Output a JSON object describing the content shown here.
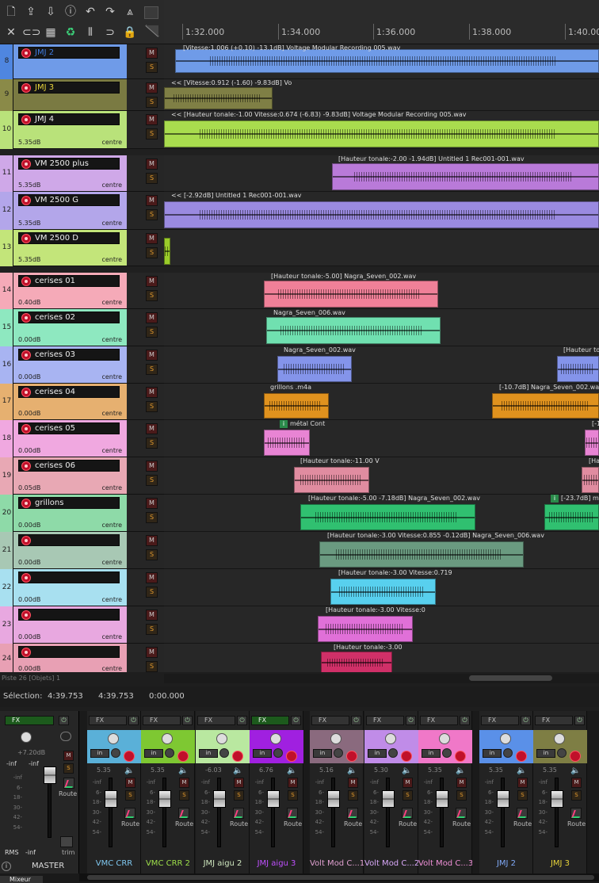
{
  "toolbar": {
    "row1": [
      "new-file-icon",
      "save-up-icon",
      "save-down-icon",
      "info-icon",
      "undo-icon",
      "redo-icon",
      "metronome-icon"
    ],
    "row2": [
      "crossfade-icon",
      "link-icon",
      "grid-icon",
      "loop-icon",
      "ripple-icon",
      "snap-icon",
      "lock-icon"
    ]
  },
  "ruler": {
    "ticks": [
      {
        "label": "1:32.000"
      },
      {
        "label": "1:34.000"
      },
      {
        "label": "1:36.000"
      },
      {
        "label": "1:38.000"
      },
      {
        "label": "1:40.000"
      }
    ]
  },
  "tracks": [
    {
      "num": "8",
      "name": "JMJ 2",
      "vol": "",
      "pan": "",
      "color": "#6f9be8",
      "numcolor": "#4f86e0",
      "lane_label": "[Vitesse:1.006 (+0.10) -13.1dB] Voltage Modular Recording 005.wav",
      "clips": [
        {
          "color": "#6f9be8"
        }
      ],
      "name_color": "#3f7be0"
    },
    {
      "num": "9",
      "name": "JMJ 3",
      "vol": "",
      "pan": "",
      "color": "#7a7a42",
      "numcolor": "#8a8a48",
      "lane_label": "<< [Vitesse:0.912 (-1.60) -9.83dB] Vo",
      "clips": [
        {
          "color": "#7f7f45"
        }
      ],
      "name_color": "#e8d43a"
    },
    {
      "num": "10",
      "name": "JMJ 4",
      "vol": "5.35dB",
      "pan": "centre",
      "color": "#b9e27a",
      "numcolor": "#b9e27a",
      "lane_label": "<< [Hauteur tonale:-1.00 Vitesse:0.674 (-6.83) -9.83dB] Voltage Modular Recording 005.wav",
      "clips": [
        {
          "color": "#a9dc4e"
        }
      ],
      "name_color": "#eee"
    },
    {
      "num": "11",
      "name": "VM 2500 plus",
      "vol": "5.35dB",
      "pan": "centre",
      "color": "#cfa8e8",
      "numcolor": "#cfa8e8",
      "lane_label": "[Hauteur tonale:-2.00 -1.94dB] Untitled 1 Rec001-001.wav",
      "clips": [
        {
          "color": "#b97ad9"
        }
      ],
      "name_color": "#eee"
    },
    {
      "num": "12",
      "name": "VM 2500 G",
      "vol": "5.35dB",
      "pan": "centre",
      "color": "#b3a6ea",
      "numcolor": "#b3a6ea",
      "lane_label": "<< [-2.92dB] Untitled 1 Rec001-001.wav",
      "clips": [
        {
          "color": "#9a8ae0"
        }
      ],
      "name_color": "#eee"
    },
    {
      "num": "13",
      "name": "VM 2500 D",
      "vol": "5.35dB",
      "pan": "centre",
      "color": "#c3e57a",
      "numcolor": "#c3e57a",
      "lane_label": "",
      "clips": [
        {
          "color": "#9acc2a"
        }
      ],
      "name_color": "#eee"
    },
    {
      "num": "14",
      "name": "cerises 01",
      "vol": "0.40dB",
      "pan": "centre",
      "color": "#f5aab8",
      "numcolor": "#f5aab8",
      "lane_label": "[Hauteur tonale:-5.00] Nagra_Seven_002.wav",
      "clips": [
        {
          "color": "#f08098"
        }
      ],
      "name_color": "#eee"
    },
    {
      "num": "15",
      "name": "cerises 02",
      "vol": "0.00dB",
      "pan": "centre",
      "color": "#8ee8c0",
      "numcolor": "#8ee8c0",
      "lane_label": "Nagra_Seven_006.wav",
      "clips": [
        {
          "color": "#70e0b0"
        }
      ],
      "name_color": "#eee"
    },
    {
      "num": "16",
      "name": "cerises 03",
      "vol": "0.00dB",
      "pan": "centre",
      "color": "#a8b4f2",
      "numcolor": "#a8b4f2",
      "lane_label": "Nagra_Seven_002.wav",
      "lane_label2": "[Hauteur to",
      "clips": [
        {
          "color": "#8494ea"
        }
      ],
      "name_color": "#eee"
    },
    {
      "num": "17",
      "name": "cerises 04",
      "vol": "0.00dB",
      "pan": "centre",
      "color": "#e6b070",
      "numcolor": "#e6b070",
      "lane_label": "grillons .m4a",
      "lane_label2": "[-10.7dB] Nagra_Seven_002.wav",
      "clips": [
        {
          "color": "#e0921e"
        }
      ],
      "name_color": "#eee"
    },
    {
      "num": "18",
      "name": "cerises 05",
      "vol": "0.00dB",
      "pan": "centre",
      "color": "#f0a8e0",
      "numcolor": "#f0a8e0",
      "lane_label": "métal Cont",
      "lane_label2": "[-1",
      "clips": [
        {
          "color": "#e884d4"
        }
      ],
      "name_color": "#eee"
    },
    {
      "num": "19",
      "name": "cerises 06",
      "vol": "0.05dB",
      "pan": "centre",
      "color": "#e8a8b4",
      "numcolor": "#e8a8b4",
      "lane_label": "[Hauteur tonale:-11.00 V",
      "lane_label2": "[Ha",
      "clips": [
        {
          "color": "#e08ca0"
        }
      ],
      "name_color": "#eee"
    },
    {
      "num": "20",
      "name": "grillons",
      "vol": "0.00dB",
      "pan": "centre",
      "color": "#8edaa8",
      "numcolor": "#8edaa8",
      "lane_label": "[Hauteur tonale:-5.00 -7.18dB] Nagra_Seven_002.wav",
      "lane_label2": "[-23.7dB] mé",
      "clips": [
        {
          "color": "#30c070"
        }
      ],
      "name_color": "#eee"
    },
    {
      "num": "21",
      "name": "",
      "vol": "0.00dB",
      "pan": "centre",
      "color": "#a8c8b4",
      "numcolor": "#a8c8b4",
      "lane_label": "[Hauteur tonale:-3.00 Vitesse:0.855 -0.12dB] Nagra_Seven_006.wav",
      "clips": [
        {
          "color": "#6a9a80"
        }
      ],
      "name_color": "#eee"
    },
    {
      "num": "22",
      "name": "",
      "vol": "0.00dB",
      "pan": "centre",
      "color": "#a8e0f0",
      "numcolor": "#a8e0f0",
      "lane_label": "[Hauteur tonale:-3.00 Vitesse:0.719",
      "clips": [
        {
          "color": "#58d0ee"
        }
      ],
      "name_color": "#eee"
    },
    {
      "num": "23",
      "name": "",
      "vol": "0.00dB",
      "pan": "centre",
      "color": "#e8a8e0",
      "numcolor": "#e8a8e0",
      "lane_label": "[Hauteur tonale:-3.00 Vitesse:0",
      "clips": [
        {
          "color": "#e070d8"
        }
      ],
      "name_color": "#eee"
    },
    {
      "num": "24",
      "name": "",
      "vol": "0.00dB",
      "pan": "centre",
      "color": "#e8a0b4",
      "numcolor": "#e8a0b4",
      "lane_label": "[Hauteur tonale:-3.00",
      "clips": [
        {
          "color": "#d03068"
        }
      ],
      "name_color": "#eee"
    }
  ],
  "status": {
    "line": "Piste 26 [Objets] 1"
  },
  "selection": {
    "label": "Sélection:",
    "start": "4:39.753",
    "end": "4:39.753",
    "length": "0:00.000"
  },
  "mixer": {
    "master": {
      "fx": "FX",
      "db": "+7.20dB",
      "left": "-inf",
      "right": "-inf",
      "rms": "RMS",
      "rms_val": "-inf",
      "route": "Route",
      "trim": "trim",
      "name": "MASTER"
    },
    "scale": [
      "-inf",
      "6-",
      "18-",
      "30-",
      "42-",
      "54-"
    ],
    "strips": [
      {
        "name": "VMC CRR",
        "peak": "5.35",
        "color": "#5ab0d8",
        "name_color": "#7fc8f0",
        "fx": "FX",
        "fx_on": false
      },
      {
        "name": "VMC CRR 2",
        "peak": "5.35",
        "color": "#7ec832",
        "name_color": "#9ee04a",
        "fx": "FX",
        "fx_on": false
      },
      {
        "name": "JMJ aigu 2",
        "peak": "-6.03",
        "color": "#b9e8a0",
        "name_color": "#d0e8c0",
        "fx": "FX",
        "fx_on": false
      },
      {
        "name": "JMJ aigu 3",
        "peak": "6.76",
        "color": "#a020e0",
        "name_color": "#c050ff",
        "fx": "FX",
        "fx_on": true
      },
      {
        "name": "Volt Mod C...1",
        "peak": "5.16",
        "color": "#8a6a7e",
        "name_color": "#e0a0d0",
        "fx": "FX",
        "fx_on": false
      },
      {
        "name": "Volt Mod C...2",
        "peak": "5.30",
        "color": "#c08ce8",
        "name_color": "#d8a8f8",
        "fx": "FX",
        "fx_on": false
      },
      {
        "name": "Volt Mod C...3",
        "peak": "5.35",
        "color": "#f078c8",
        "name_color": "#f090d8",
        "fx": "FX",
        "fx_on": false
      },
      {
        "name": "JMJ 2",
        "peak": "5.35",
        "color": "#5a90e8",
        "name_color": "#80aaf8",
        "fx": "FX",
        "fx_on": false
      },
      {
        "name": "JMJ 3",
        "peak": "5.35",
        "color": "#7e7e44",
        "name_color": "#e8d43a",
        "fx": "FX",
        "fx_on": false
      }
    ],
    "in_label": "in",
    "mute": "M",
    "solo": "S",
    "route": "Route",
    "tab": "Mixeur"
  },
  "colors": {
    "accent_green": "#3cd27a",
    "record_red": "#c0102a",
    "background": "#1e1e1e"
  }
}
